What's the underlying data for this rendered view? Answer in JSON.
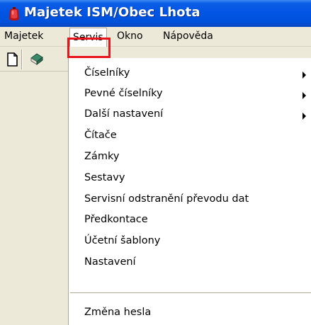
{
  "window": {
    "title": "Majetek ISM/Obec Lhota",
    "titlebar_color": "#0255e3"
  },
  "menubar": {
    "items": [
      {
        "label": "Majetek"
      },
      {
        "label": "Servis",
        "active": true
      },
      {
        "label": "Okno"
      },
      {
        "label": "Nápověda"
      }
    ],
    "highlight_color": "#e8141b"
  },
  "toolbar": {
    "buttons": [
      {
        "icon": "new-document-icon"
      },
      {
        "icon": "book-icon"
      }
    ]
  },
  "servis_menu": {
    "items": [
      {
        "label": "Číselníky",
        "submenu": true
      },
      {
        "label": "Pevné číselníky",
        "submenu": true
      },
      {
        "label": "Další nastavení",
        "submenu": true
      },
      {
        "label": "Čítače",
        "submenu": false
      },
      {
        "label": "Zámky",
        "submenu": false
      },
      {
        "label": "Sestavy",
        "submenu": false
      },
      {
        "label": "Servisní odstranění převodu dat",
        "submenu": false
      },
      {
        "label": "Předkontace",
        "submenu": false
      },
      {
        "label": "Účetní šablony",
        "submenu": false
      },
      {
        "label": "Nastavení",
        "submenu": false
      },
      {
        "label": "Změna hesla",
        "submenu": false
      }
    ]
  }
}
